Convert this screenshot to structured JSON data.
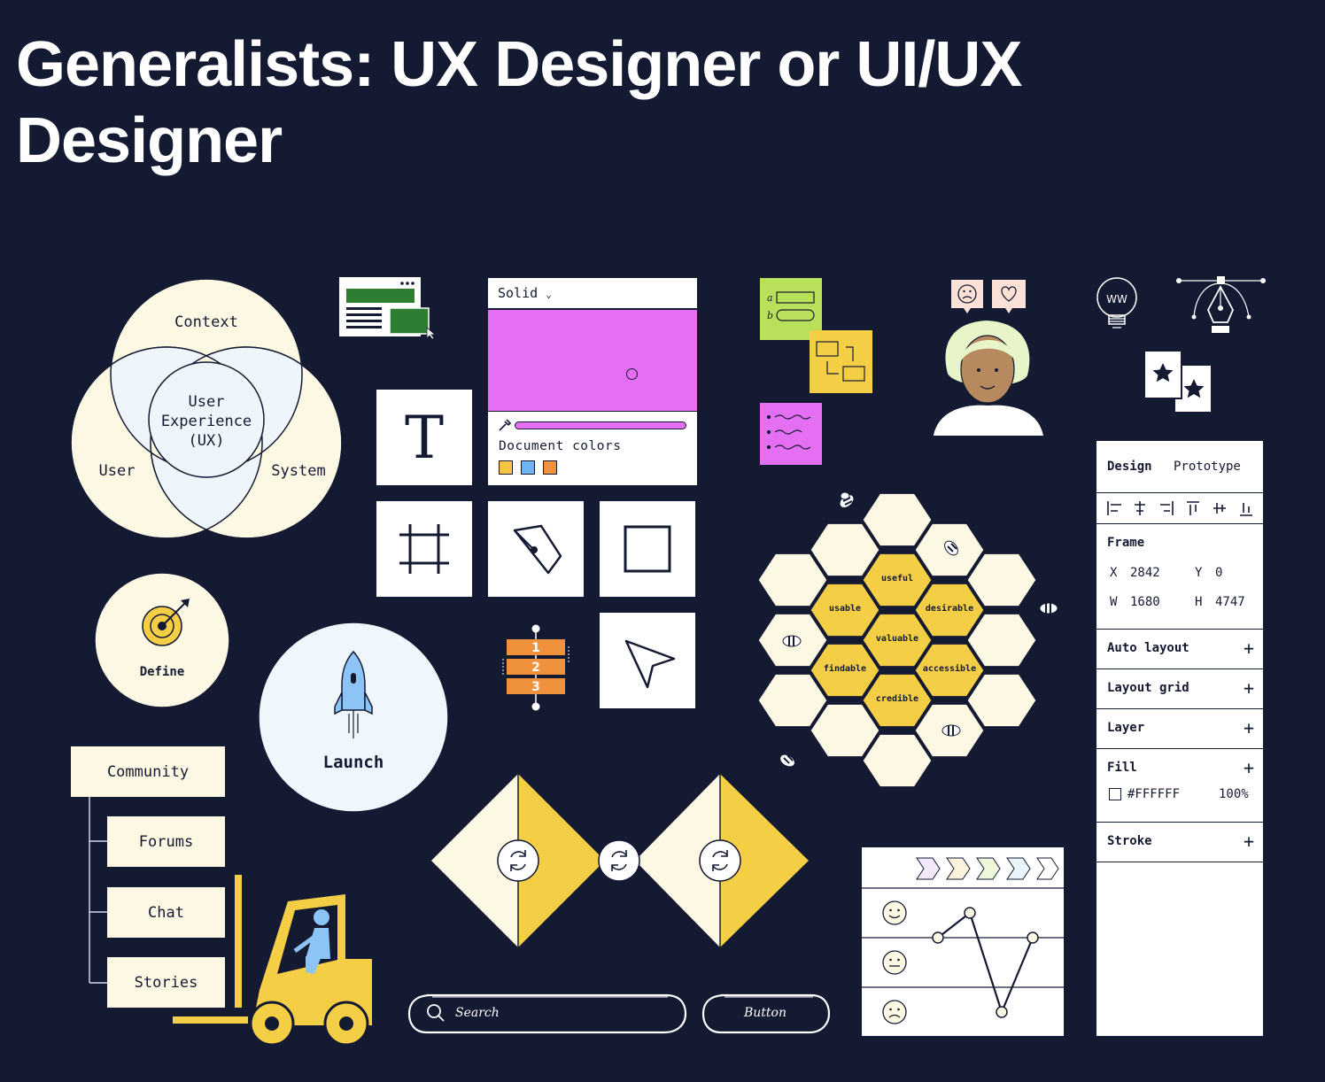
{
  "page": {
    "title": "Generalists: UX Designer or UI/UX Designer"
  },
  "venn": {
    "circles": [
      "Context",
      "User",
      "System"
    ],
    "center": [
      "User",
      "Experience",
      "(UX)"
    ]
  },
  "define": {
    "label": "Define"
  },
  "launch": {
    "label": "Launch"
  },
  "color_picker": {
    "mode": "Solid",
    "swatch_color": "#e56ff2",
    "document_colors_label": "Document colors",
    "document_colors": [
      "#f4c542",
      "#6fb3f2",
      "#f0923b"
    ]
  },
  "tools": {
    "text_glyph": "T"
  },
  "layer_stack": {
    "items": [
      "1",
      "2",
      "3"
    ]
  },
  "sticky_notes": {
    "note_a_labels": [
      "a",
      "b"
    ]
  },
  "honeycomb": {
    "words": [
      "useful",
      "usable",
      "desirable",
      "valuable",
      "findable",
      "accessible",
      "credible"
    ]
  },
  "tree": {
    "root": "Community",
    "children": [
      "Forums",
      "Chat",
      "Stories"
    ]
  },
  "search_bar": {
    "placeholder": "Search"
  },
  "sketch_button": {
    "label": "Button"
  },
  "icon_bulb": {
    "text": "WW"
  },
  "design_panel": {
    "tabs": [
      "Design",
      "Prototype"
    ],
    "frame_label": "Frame",
    "x_label": "X",
    "x_value": "2842",
    "y_label": "Y",
    "y_value": "0",
    "w_label": "W",
    "w_value": "1680",
    "h_label": "H",
    "h_value": "4747",
    "sections": [
      "Auto layout",
      "Layout grid",
      "Layer"
    ],
    "fill_label": "Fill",
    "fill_hex": "#FFFFFF",
    "fill_opacity": "100%",
    "stroke_label": "Stroke"
  },
  "journey_chart": {
    "mood_values": [
      0.5,
      1,
      -1,
      0.5
    ]
  },
  "colors": {
    "background": "#151a33",
    "cream": "#fdf8e4",
    "yellow": "#f4cf45",
    "green": "#2f7d32",
    "lime": "#b8e05a",
    "magenta": "#e56ff2",
    "orange": "#f0923b",
    "sky": "#8bc4f5"
  }
}
